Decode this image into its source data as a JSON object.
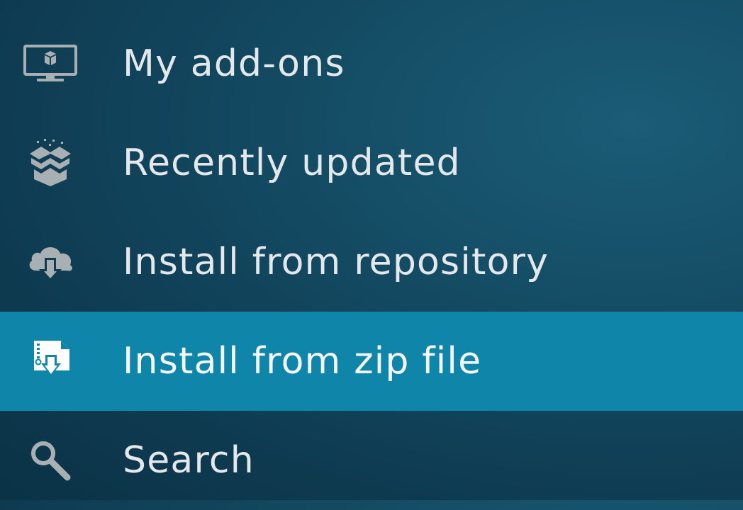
{
  "menu": {
    "items": [
      {
        "label": "My add-ons",
        "icon": "monitor-addon-icon",
        "selected": false
      },
      {
        "label": "Recently updated",
        "icon": "open-box-icon",
        "selected": false
      },
      {
        "label": "Install from repository",
        "icon": "cloud-download-icon",
        "selected": false
      },
      {
        "label": "Install from zip file",
        "icon": "zip-file-download-icon",
        "selected": true
      },
      {
        "label": "Search",
        "icon": "search-icon",
        "selected": false
      }
    ]
  },
  "colors": {
    "background": "#134a62",
    "selected_row": "#0f86a9",
    "icon_gray": "#a9b0b3",
    "text": "#e4e8ea"
  }
}
